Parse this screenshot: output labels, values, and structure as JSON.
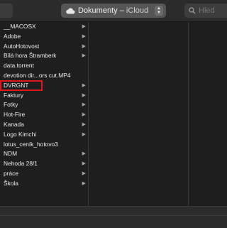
{
  "toolbar": {
    "location_folder": "Dokumenty",
    "location_separator": " – ",
    "location_service": "iCloud",
    "location_icon": "icloud-icon",
    "search_placeholder": "Hled"
  },
  "browser": {
    "items": [
      {
        "label": "__MACOSX",
        "has_children": true
      },
      {
        "label": "Adobe",
        "has_children": true
      },
      {
        "label": "AutoHotovost",
        "has_children": true
      },
      {
        "label": "Bílá hora Štramberk",
        "has_children": true
      },
      {
        "label": "data.torrent",
        "has_children": false,
        "highlighted": true
      },
      {
        "label": "devotion dir...ors cut.MP4",
        "has_children": false
      },
      {
        "label": "DVRGNT",
        "has_children": true
      },
      {
        "label": "Faktury",
        "has_children": true
      },
      {
        "label": "Fotky",
        "has_children": true
      },
      {
        "label": "Hot-Fire",
        "has_children": true
      },
      {
        "label": "Kanada",
        "has_children": true
      },
      {
        "label": "Logo Kimchi",
        "has_children": true
      },
      {
        "label": "lotus_ceník_hotovo3",
        "has_children": false
      },
      {
        "label": "NDM",
        "has_children": true
      },
      {
        "label": "Nehoda 28/1",
        "has_children": true
      },
      {
        "label": "práce",
        "has_children": true
      },
      {
        "label": "Škola",
        "has_children": true
      }
    ],
    "highlight_color": "#e0161d",
    "chevron_icon": "chevron-right-icon"
  }
}
